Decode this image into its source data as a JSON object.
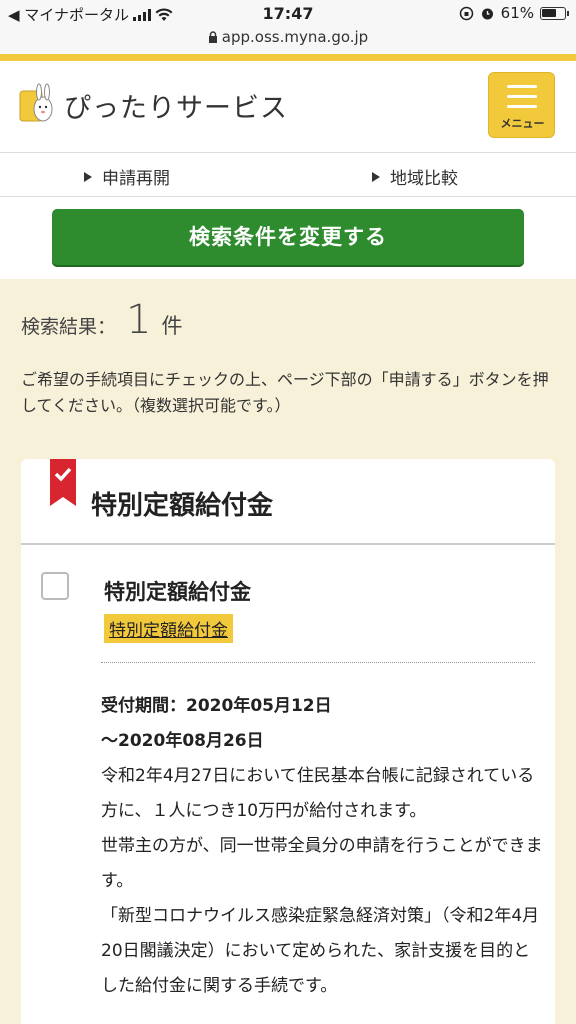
{
  "status_bar": {
    "back_label": "◀ マイナポータル",
    "time": "17:47",
    "battery": "61%",
    "url": "app.oss.myna.go.jp"
  },
  "header": {
    "site_name": "ぴったりサービス",
    "menu_label": "メニュー"
  },
  "sub_nav": {
    "items": [
      {
        "label": "申請再開"
      },
      {
        "label": "地域比較"
      }
    ]
  },
  "search": {
    "change_button": "検索条件を変更する"
  },
  "results": {
    "count_label": "検索結果：",
    "count": "1",
    "count_unit": "件",
    "instructions": "ご希望の手続項目にチェックの上、ページ下部の「申請する」ボタンを押してください。（複数選択可能です。）"
  },
  "card": {
    "title": "特別定額給付金",
    "procedure_name": "特別定額給付金",
    "procedure_tag": "特別定額給付金",
    "period_line1": "受付期間：2020年05月12日",
    "period_line2": "〜2020年08月26日",
    "description": "令和2年4月27日において住民基本台帳に記録されている方に、１人につき10万円が給付されます。\n世帯主の方が、同一世帯全員分の申請を行うことができます。\n「新型コロナウイルス感染症緊急経済対策」（令和2年4月20日閣議決定）において定められた、家計支援を目的とした給付金に関する手続です。"
  },
  "colors": {
    "accent_yellow": "#f3c93c",
    "button_green": "#2e8b2e",
    "bookmark_red": "#d9252f",
    "results_bg": "#f8f1da"
  }
}
